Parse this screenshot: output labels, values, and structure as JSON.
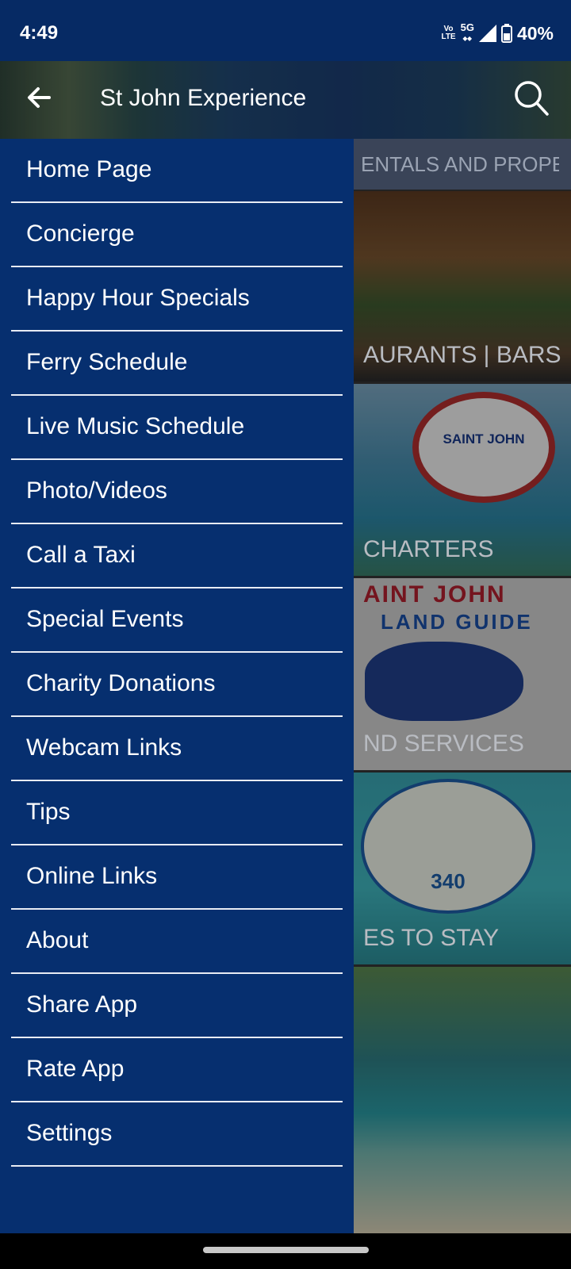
{
  "status_bar": {
    "time": "4:49",
    "volte_line1": "Vo",
    "volte_line2": "LTE",
    "network": "5G",
    "battery": "40%"
  },
  "app_bar": {
    "title": "St John Experience",
    "back_icon": "arrow-left-icon",
    "search_icon": "search-icon"
  },
  "drawer": {
    "items": [
      {
        "label": "Home Page"
      },
      {
        "label": "Concierge"
      },
      {
        "label": "Happy Hour Specials"
      },
      {
        "label": "Ferry Schedule"
      },
      {
        "label": "Live Music Schedule"
      },
      {
        "label": "Photo/Videos"
      },
      {
        "label": "Call a Taxi"
      },
      {
        "label": "Special Events"
      },
      {
        "label": "Charity Donations"
      },
      {
        "label": "Webcam Links"
      },
      {
        "label": "Tips"
      },
      {
        "label": "Online Links"
      },
      {
        "label": "About"
      },
      {
        "label": "Share App"
      },
      {
        "label": "Rate App"
      },
      {
        "label": "Settings"
      }
    ]
  },
  "background": {
    "category_bar": "ENTALS AND PROPE",
    "tiles": [
      {
        "label": "AURANTS | BARS"
      },
      {
        "label": "CHARTERS",
        "badge_text": "SAINT JOHN"
      },
      {
        "label": "ND SERVICES",
        "guide_head": "AINT JOHN",
        "guide_sub": "LAND GUIDE"
      },
      {
        "label": "ES TO STAY",
        "logo_number": "340"
      },
      {
        "label": ""
      }
    ]
  },
  "colors": {
    "drawer_bg": "#062f6f",
    "status_bar_bg": "#062a64",
    "text": "#ffffff"
  }
}
